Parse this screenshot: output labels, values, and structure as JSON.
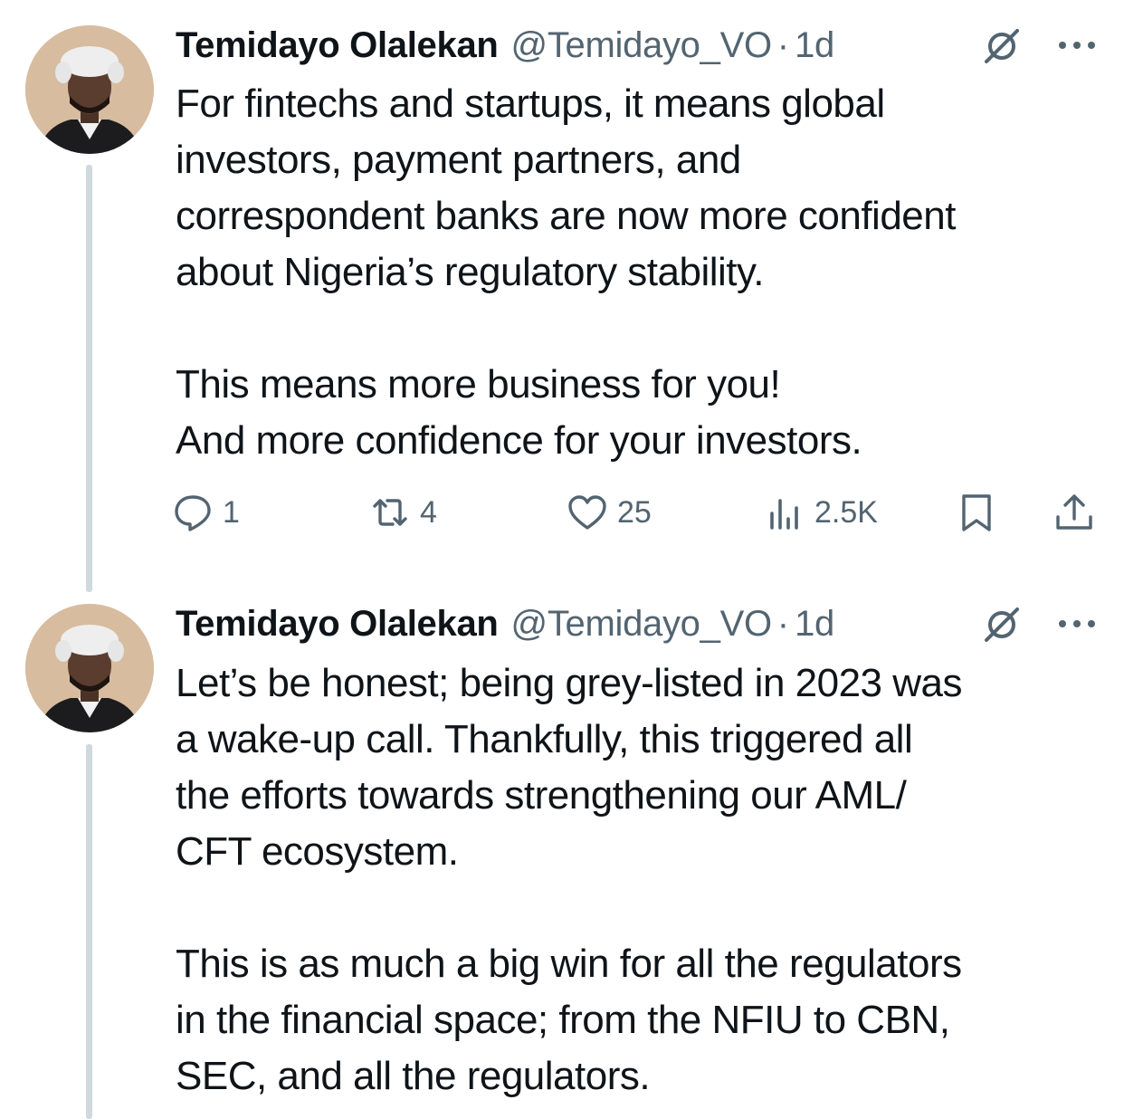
{
  "tweets": [
    {
      "author": {
        "name": "Temidayo Olalekan",
        "handle": "@Temidayo_VO",
        "separator": "·",
        "time": "1d"
      },
      "paragraphs": [
        "For fintechs and startups, it means global\ninvestors, payment partners, and\ncorrespondent banks are now more confident\nabout Nigeria’s regulatory stability.",
        "This means more business for you!\nAnd more confidence for your investors."
      ],
      "metrics": {
        "replies": "1",
        "reposts": "4",
        "likes": "25",
        "views": "2.5K"
      }
    },
    {
      "author": {
        "name": "Temidayo Olalekan",
        "handle": "@Temidayo_VO",
        "separator": "·",
        "time": "1d"
      },
      "paragraphs": [
        "Let’s be honest; being grey-listed in 2023 was\na wake-up call. Thankfully, this triggered all\nthe efforts towards strengthening our AML/\nCFT ecosystem.",
        "This is as much a big win for all the regulators\nin the financial space; from the NFIU to CBN,\nSEC, and all the regulators."
      ]
    }
  ],
  "icons": {
    "grok": "grok-icon",
    "more": "more-icon",
    "reply": "reply-icon",
    "repost": "repost-icon",
    "like": "heart-icon",
    "views": "views-icon",
    "bookmark": "bookmark-icon",
    "share": "share-icon"
  },
  "colors": {
    "text": "#0f1419",
    "secondary": "#536471",
    "thread_line": "#cfd9de"
  }
}
